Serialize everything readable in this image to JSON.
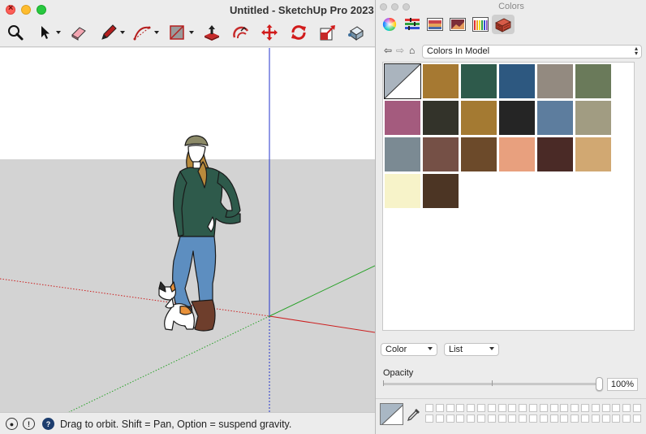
{
  "window": {
    "title": "Untitled - SketchUp Pro 2023"
  },
  "toolbar": {
    "tools": [
      {
        "name": "zoom-extents",
        "icon": "magnifier-icon"
      },
      {
        "name": "select",
        "icon": "arrow-cursor-icon"
      },
      {
        "name": "eraser",
        "icon": "eraser-icon"
      },
      {
        "name": "line",
        "icon": "pencil-icon"
      },
      {
        "name": "arc",
        "icon": "arc-icon"
      },
      {
        "name": "rectangle",
        "icon": "rectangle-icon"
      },
      {
        "name": "push-pull",
        "icon": "push-pull-icon"
      },
      {
        "name": "offset",
        "icon": "offset-icon"
      },
      {
        "name": "move",
        "icon": "move-arrows-icon"
      },
      {
        "name": "rotate",
        "icon": "rotate-icon"
      },
      {
        "name": "scale",
        "icon": "scale-icon"
      },
      {
        "name": "paint-bucket",
        "icon": "paint-bucket-icon"
      }
    ]
  },
  "viewport": {
    "sky_color": "#ffffff",
    "ground_color": "#d3d3d3",
    "axis_colors": {
      "red": "#cc1e1e",
      "green": "#27a127",
      "blue": "#2233cc"
    }
  },
  "status": {
    "text": "Drag to orbit. Shift = Pan, Option = suspend gravity."
  },
  "colors_panel": {
    "title": "Colors",
    "modes": [
      "color-wheel-icon",
      "color-sliders-icon",
      "color-palettes-icon",
      "image-palettes-icon",
      "pencils-icon",
      "sketchup-materials-icon"
    ],
    "active_mode": 5,
    "list_name": "Colors In Model",
    "swatches": [
      "#aab4be",
      "#a67932",
      "#2e5a4b",
      "#2d5880",
      "#938a80",
      "#6a7a5a",
      "#a45b7e",
      "#33332a",
      "#a47a32",
      "#252525",
      "#5d7d9e",
      "#a19c82",
      "#7b8a93",
      "#755046",
      "#6c4a2a",
      "#e8a07e",
      "#4a2a26",
      "#d1a872",
      "#f7f3c9",
      "#4c3524"
    ],
    "selected_swatch": 0,
    "view_mode": "Color",
    "sort_mode": "List",
    "opacity_label": "Opacity",
    "opacity_value": "100%",
    "opacity_fraction": 1.0,
    "current_color": "#a9b7c4"
  }
}
